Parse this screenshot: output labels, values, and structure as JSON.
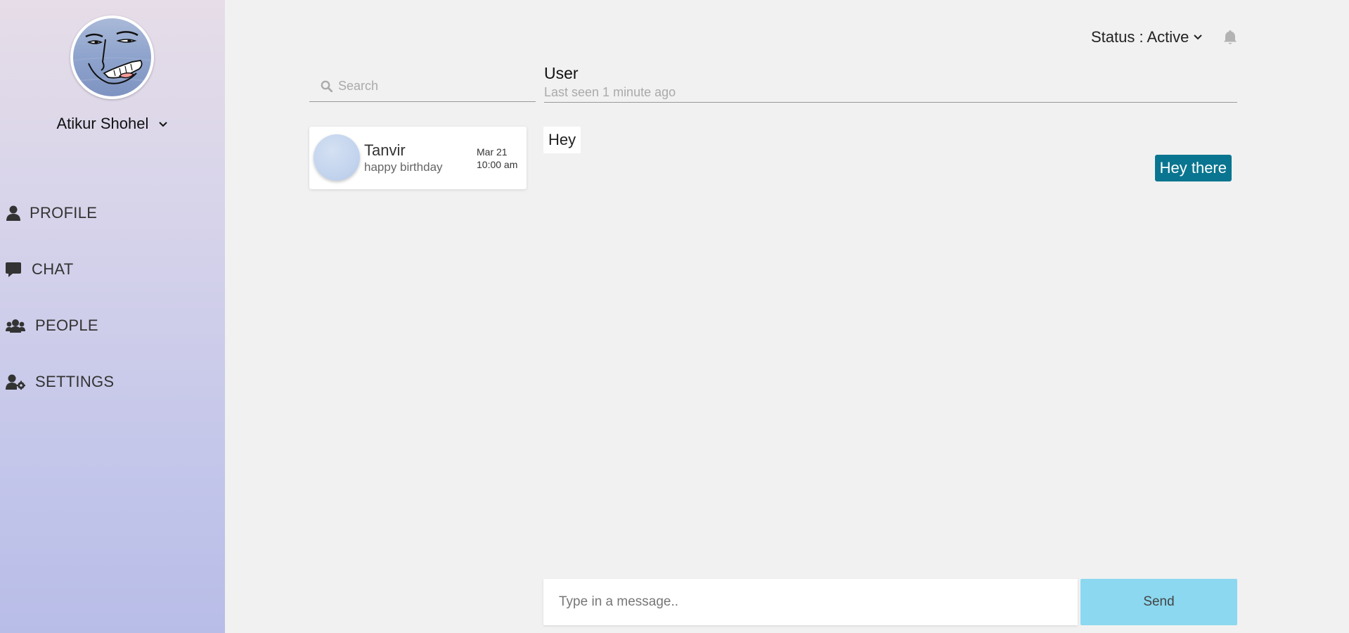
{
  "sidebar": {
    "user_name": "Atikur Shohel",
    "nav": [
      {
        "label": "PROFILE",
        "icon": "user-icon"
      },
      {
        "label": "CHAT",
        "icon": "comment-icon"
      },
      {
        "label": "PEOPLE",
        "icon": "users-icon"
      },
      {
        "label": "SETTINGS",
        "icon": "user-cog-icon"
      }
    ]
  },
  "header": {
    "status_label": "Status : Active",
    "notification_icon": "bell-icon"
  },
  "search": {
    "placeholder": "Search"
  },
  "chat_header": {
    "name": "User",
    "last_seen": "Last seen 1 minute ago"
  },
  "conversations": [
    {
      "name": "Tanvir",
      "last_message": "happy birthday",
      "date": "Mar 21",
      "time": "10:00 am"
    }
  ],
  "messages": [
    {
      "direction": "in",
      "text": "Hey"
    },
    {
      "direction": "out",
      "text": "Hey there"
    }
  ],
  "composer": {
    "placeholder": "Type in a message..",
    "send_label": "Send"
  },
  "colors": {
    "outgoing_bubble": "#097590",
    "send_button": "#8bd8f0",
    "background": "#f1f1f1"
  }
}
